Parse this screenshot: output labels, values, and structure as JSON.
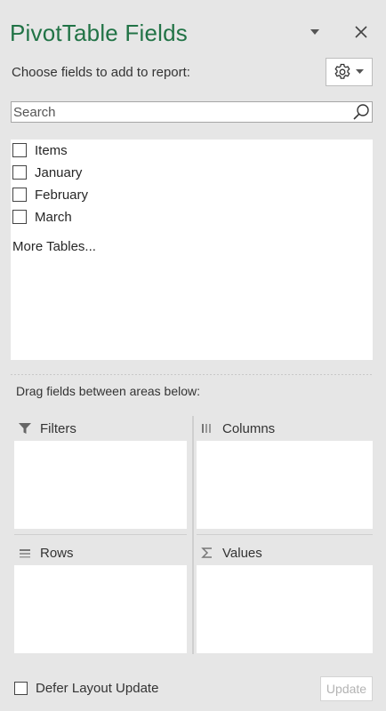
{
  "header": {
    "title": "PivotTable Fields",
    "title_color": "#217346"
  },
  "chooser": {
    "label": "Choose fields to add to report:",
    "tools_icon": "gear-icon"
  },
  "search": {
    "placeholder": "Search",
    "value": ""
  },
  "fields": {
    "items": [
      {
        "label": "Items",
        "checked": false
      },
      {
        "label": "January",
        "checked": false
      },
      {
        "label": "February",
        "checked": false
      },
      {
        "label": "March",
        "checked": false
      }
    ],
    "more_tables": "More Tables..."
  },
  "areas": {
    "instruction": "Drag fields between areas below:",
    "filters": {
      "label": "Filters",
      "icon": "filter-icon"
    },
    "columns": {
      "label": "Columns",
      "icon": "columns-icon"
    },
    "rows": {
      "label": "Rows",
      "icon": "rows-icon"
    },
    "values": {
      "label": "Values",
      "icon": "sigma-icon"
    }
  },
  "footer": {
    "defer_label": "Defer Layout Update",
    "defer_checked": false,
    "update_label": "Update",
    "update_enabled": false
  }
}
